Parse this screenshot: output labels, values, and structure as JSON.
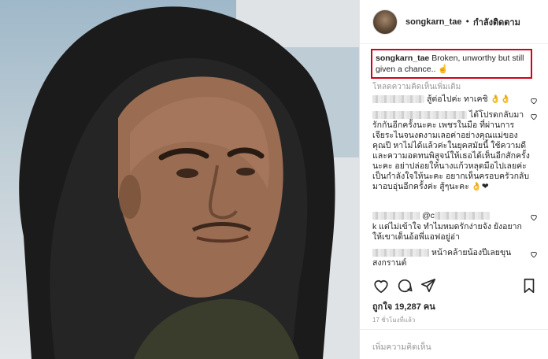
{
  "post": {
    "username": "songkarn_tae",
    "follow_label": "กำลังติดตาม",
    "caption_text": "Broken, unworthy but still given a chance..",
    "caption_emoji": "☝",
    "load_more": "โหลดความคิดเห็นเพิ่มเติม",
    "likes": "ถูกใจ 19,287 คน",
    "time": "17 ชั่วโมงที่แล้ว",
    "add_comment_placeholder": "เพิ่มความคิดเห็น"
  },
  "comments": [
    {
      "text": "สู้ต่อไปค่ะ ทาเคชิ 👌👌"
    },
    {
      "text": "ได้โปรดกลับมารักกันอีกครั้งนะคะ เพชรในมือ ที่ผ่านการเจียระไนจนงดงามเลอค่าอย่างคุณแม่ของคุณปี หาไม่ได้แล้วค่ะในยุคสมัยนี้ ใช้ความดีและความอดทนพิสูจน์ให้เธอได้เห็นอีกสักครั้งนะคะ อย่าปล่อยให้นางแก้วหลุดมือไปเลยค่ะ เป็นกำลังใจให้นะคะ อยากเห็นครอบครัวกลับมาอบอุ่นอีกครั้งค่ะ สู้ๆนะคะ 👌❤"
    },
    {
      "text": "@c"
    },
    {
      "text": "k แต่ไม่เข้าใจ ทำไมหมดรักง่ายจัง ยังอยากให้เขาเด็นอ้อพี่แอฟอยู่อ่า"
    },
    {
      "text": "หน้าคล้ายน้องปีเลยขุนสงกรานต์"
    }
  ],
  "icons": {
    "like": "heart-icon",
    "comment": "comment-icon",
    "share": "share-icon",
    "save": "bookmark-icon"
  },
  "colors": {
    "highlight_border": "#d0021b",
    "meta_text": "#999999",
    "primary_text": "#262626"
  }
}
